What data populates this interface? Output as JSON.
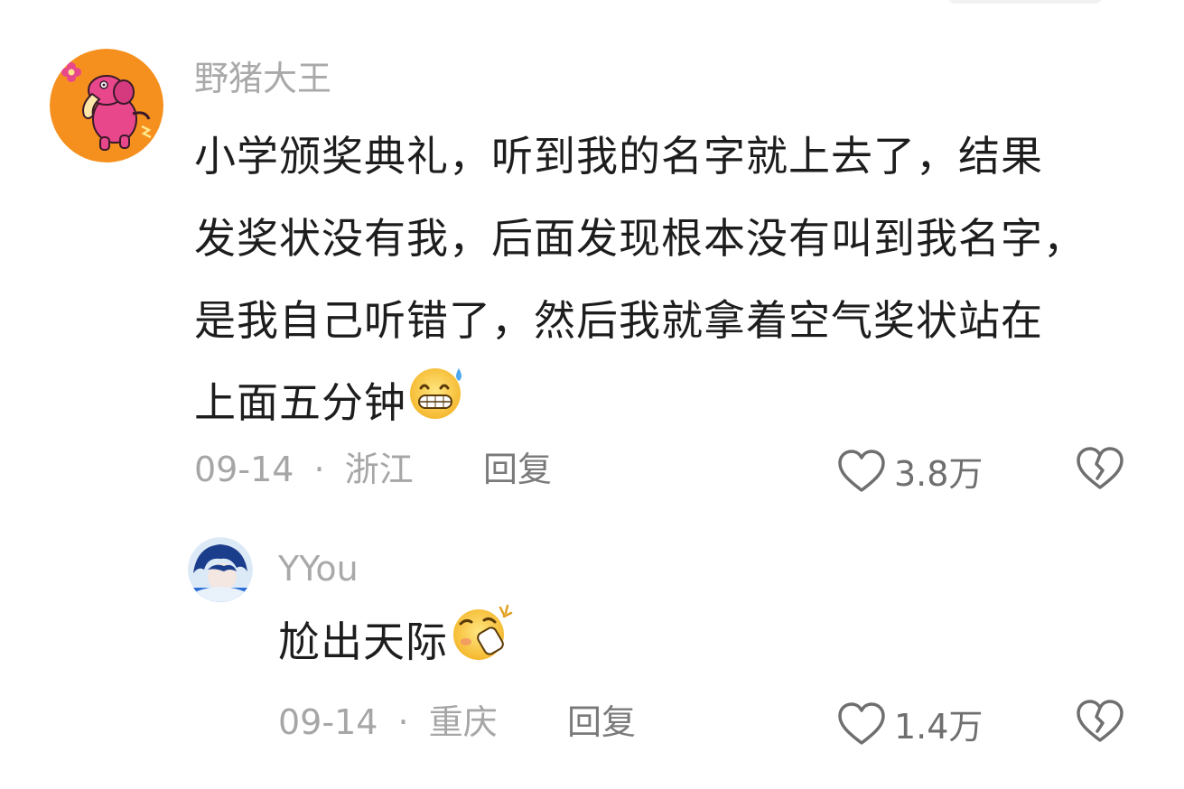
{
  "comments": [
    {
      "username": "野猪大王",
      "body": "小学颁奖典礼，听到我的名字就上去了，结果发奖状没有我，后面发现根本没有叫到我名字，是我自己听错了，然后我就拿着空气奖状站在上面五分钟",
      "body_lines": [
        "小学颁奖典礼，听到我的名字就上去了，结果",
        "发奖状没有我，后面发现根本没有叫到我名字，",
        "是我自己听错了，然后我就拿着空气奖状站在",
        "上面五分钟"
      ],
      "emoji": "grin-sweat-emoji",
      "date": "09-14",
      "separator": "·",
      "location": "浙江",
      "reply_label": "回复",
      "likes": "3.8万",
      "avatar": "pink-elephant-avatar",
      "avatar_color": "#F5901E"
    },
    {
      "username": "YYou",
      "body": "尬出天际",
      "emoji": "embarrassed-emoji",
      "date": "09-14",
      "separator": "·",
      "location": "重庆",
      "reply_label": "回复",
      "likes": "1.4万",
      "avatar": "anime-boy-avatar"
    }
  ],
  "icons": {
    "like": "heart-outline-icon",
    "dislike": "broken-heart-icon"
  },
  "colors": {
    "username": "#A9A9A9",
    "body": "#1D1D1D",
    "meta": "#A6A6A6"
  }
}
